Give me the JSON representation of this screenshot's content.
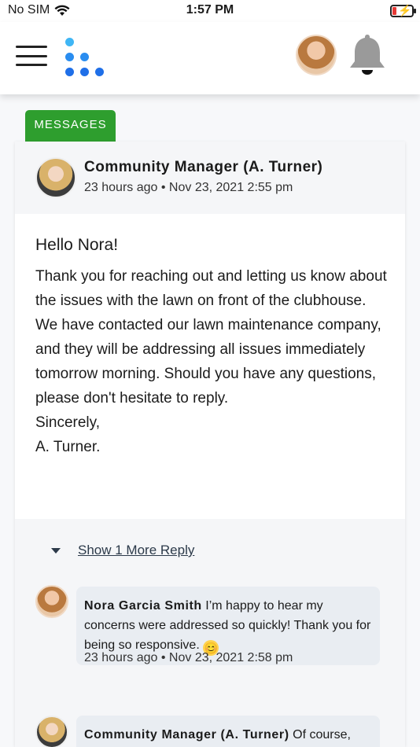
{
  "status_bar": {
    "carrier": "No SIM",
    "time": "1:57 PM"
  },
  "header": {
    "menu_icon": "hamburger-menu-icon",
    "logo_icon": "dots-logo-icon",
    "notifications_icon": "bell-icon"
  },
  "tab": {
    "label": "MESSAGES",
    "color": "#2e9e2e"
  },
  "message": {
    "author": "Community Manager (A. Turner)",
    "relative_time": "23 hours ago",
    "separator": "•",
    "date": "Nov 23, 2021 2:55 pm",
    "greeting": "Hello Nora!",
    "paragraph": "Thank you for reaching out and letting us know about the issues with the lawn on front of the clubhouse. We have contacted our lawn maintenance company, and they will be addressing all issues immediately tomorrow morning. Should you have any questions, please don't hesitate to reply.",
    "closing": "Sincerely,",
    "signature": "A. Turner."
  },
  "replies": {
    "show_more_label": "Show 1 More Reply",
    "items": [
      {
        "author": "Nora Garcia Smith",
        "text": "I’m happy to hear my concerns were addressed so quickly! Thank you for being so responsive.",
        "emoji": "😊",
        "relative_time": "23 hours ago",
        "separator": "•",
        "date": "Nov 23, 2021 2:58 pm"
      },
      {
        "author": "Community Manager (A. Turner)",
        "text": "Of course,"
      }
    ]
  }
}
